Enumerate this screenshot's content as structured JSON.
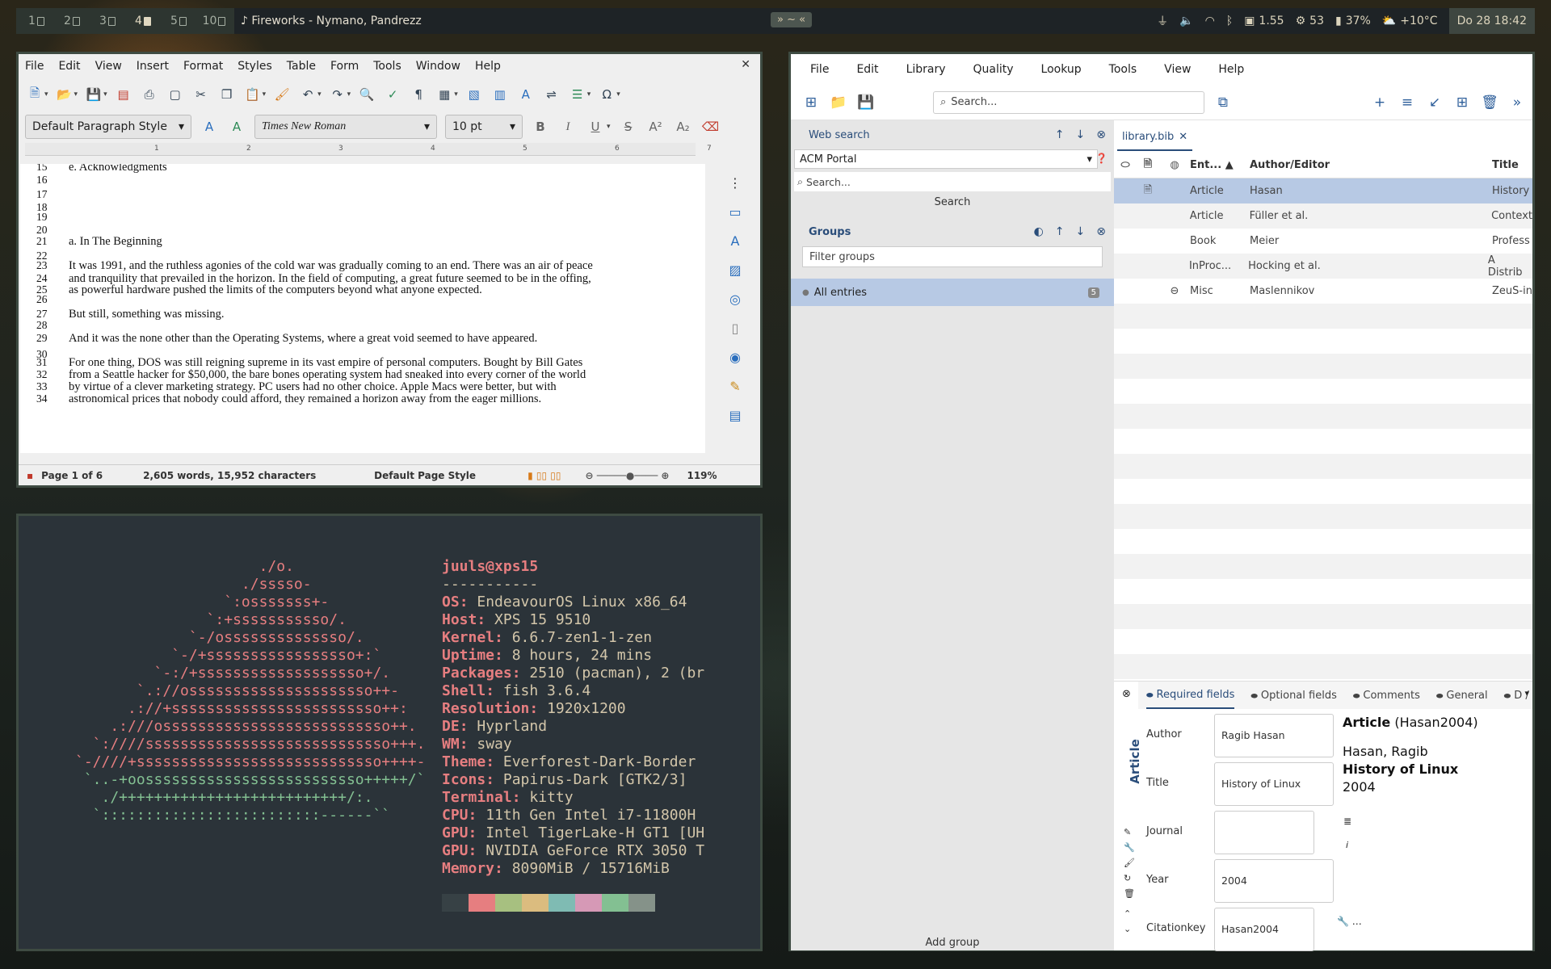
{
  "topbar": {
    "workspaces": [
      {
        "num": "1",
        "active": false
      },
      {
        "num": "2",
        "active": false
      },
      {
        "num": "3",
        "active": false
      },
      {
        "num": "4",
        "active": true
      },
      {
        "num": "5",
        "active": false
      },
      {
        "num": "10",
        "active": false
      }
    ],
    "now_playing": "♪ Fireworks - Nymano, Pandrezz",
    "center_tag": "» ~ «",
    "cpu_load": "1.55",
    "mem": "53",
    "battery": "37%",
    "weather": "+10°C",
    "clock": "Do 28 18:42"
  },
  "writer": {
    "menu": [
      "File",
      "Edit",
      "View",
      "Insert",
      "Format",
      "Styles",
      "Table",
      "Form",
      "Tools",
      "Window",
      "Help"
    ],
    "paragraph_style": "Default Paragraph Style",
    "font_name": "Times New Roman",
    "font_size": "10 pt",
    "ruler_marks": [
      "1",
      "2",
      "3",
      "4",
      "5",
      "6",
      "7"
    ],
    "doc_lines": [
      {
        "n": "15",
        "t": "   e. Acknowledgments"
      },
      {
        "n": "16",
        "t": ""
      },
      {
        "n": "17",
        "t": ""
      },
      {
        "n": "18",
        "t": ""
      },
      {
        "n": "19",
        "t": ""
      },
      {
        "n": "20",
        "t": ""
      },
      {
        "n": "21",
        "t": "a. In The Beginning"
      },
      {
        "n": "22",
        "t": ""
      },
      {
        "n": "23",
        "t": "It was 1991, and the ruthless agonies of the cold war was gradually coming to an end. There was an air of peace"
      },
      {
        "n": "24",
        "t": "and tranquility that prevailed in the horizon. In the field of computing, a great future seemed to be in the offing,"
      },
      {
        "n": "25",
        "t": "as powerful hardware pushed the limits of the computers beyond what anyone expected."
      },
      {
        "n": "26",
        "t": ""
      },
      {
        "n": "27",
        "t": "But still, something was missing."
      },
      {
        "n": "28",
        "t": ""
      },
      {
        "n": "29",
        "t": "And it was the none other than the Operating Systems, where a great void seemed to have appeared."
      },
      {
        "n": "30",
        "t": ""
      },
      {
        "n": "31",
        "t": "For one thing, DOS was still reigning supreme in its vast empire of personal computers. Bought by Bill Gates"
      },
      {
        "n": "32",
        "t": "from a Seattle hacker for $50,000, the bare bones operating system had sneaked into every corner of the world"
      },
      {
        "n": "33",
        "t": "by virtue of a clever marketing strategy. PC users had no other choice. Apple Macs were better, but with"
      },
      {
        "n": "34",
        "t": "astronomical prices that nobody could afford, they remained a horizon away from the eager millions."
      }
    ],
    "status": {
      "page": "Page 1 of 6",
      "words": "2,605 words, 15,952 characters",
      "page_style": "Default Page Style",
      "zoom": "119%"
    }
  },
  "terminal": {
    "ascii_lines": [
      {
        "t": "                     ./o.",
        "c": "#e67e80"
      },
      {
        "t": "                   ./sssso-",
        "c": "#e67e80"
      },
      {
        "t": "                 `:osssssss+-",
        "c": "#e67e80"
      },
      {
        "t": "               `:+sssssssssso/.",
        "c": "#e67e80"
      },
      {
        "t": "             `-/ossssssssssssso/.",
        "c": "#e67e80"
      },
      {
        "t": "           `-/+sssssssssssssssso+:`",
        "c": "#e67e80"
      },
      {
        "t": "         `-:/+sssssssssssssssssso+/.",
        "c": "#e67e80"
      },
      {
        "t": "       `.://osssssssssssssssssssso++-",
        "c": "#e67e80"
      },
      {
        "t": "      .://+ssssssssssssssssssssssso++:",
        "c": "#e67e80"
      },
      {
        "t": "    .:///ossssssssssssssssssssssssso++.",
        "c": "#e67e80"
      },
      {
        "t": "  `:////ssssssssssssssssssssssssssso+++.",
        "c": "#e67e80"
      },
      {
        "t": "`-////+ssssssssssssssssssssssssssso++++-",
        "c": "#e67e80"
      },
      {
        "t": " `..-+oosssssssssssssssssssssssso+++++/`",
        "c": "#83c092"
      },
      {
        "t": "   ./++++++++++++++++++++++++++/:.",
        "c": "#83c092"
      },
      {
        "t": "  `:::::::::::::::::::::::::------``",
        "c": "#83c092"
      }
    ],
    "user": "juuls@xps15",
    "separator": "-----------",
    "info": [
      {
        "k": "OS",
        "v": "EndeavourOS Linux x86_64"
      },
      {
        "k": "Host",
        "v": "XPS 15 9510"
      },
      {
        "k": "Kernel",
        "v": "6.6.7-zen1-1-zen"
      },
      {
        "k": "Uptime",
        "v": "8 hours, 24 mins"
      },
      {
        "k": "Packages",
        "v": "2510 (pacman), 2 (br"
      },
      {
        "k": "Shell",
        "v": "fish 3.6.4"
      },
      {
        "k": "Resolution",
        "v": "1920x1200"
      },
      {
        "k": "DE",
        "v": "Hyprland"
      },
      {
        "k": "WM",
        "v": "sway"
      },
      {
        "k": "Theme",
        "v": "Everforest-Dark-Border"
      },
      {
        "k": "Icons",
        "v": "Papirus-Dark [GTK2/3]"
      },
      {
        "k": "Terminal",
        "v": "kitty"
      },
      {
        "k": "CPU",
        "v": "11th Gen Intel i7-11800H"
      },
      {
        "k": "GPU",
        "v": "Intel TigerLake-H GT1 [UH"
      },
      {
        "k": "GPU",
        "v": "NVIDIA GeForce RTX 3050 T"
      },
      {
        "k": "Memory",
        "v": "8090MiB / 15716MiB"
      }
    ],
    "palette": [
      "#374145",
      "#e67e80",
      "#a7c080",
      "#dbbc7f",
      "#7fbbb3",
      "#d699b6",
      "#83c092",
      "#859289"
    ]
  },
  "jabref": {
    "menu": [
      "File",
      "Edit",
      "Library",
      "Quality",
      "Lookup",
      "Tools",
      "View",
      "Help"
    ],
    "search_placeholder": "Search...",
    "web_search": {
      "title": "Web search",
      "engine": "ACM Portal",
      "search_placeholder": "Search...",
      "search_button": "Search"
    },
    "groups": {
      "title": "Groups",
      "filter_placeholder": "Filter groups",
      "all_entries": "All entries",
      "count": "5",
      "add_group": "Add group"
    },
    "tab": "library.bib",
    "columns": {
      "entry": "Ent...",
      "author": "Author/Editor",
      "title": "Title"
    },
    "entries": [
      {
        "type": "Article",
        "author": "Hasan",
        "title": "History",
        "icon": "file",
        "selected": true
      },
      {
        "type": "Article",
        "author": "Füller et al.",
        "title": "Context",
        "icon": "",
        "selected": false
      },
      {
        "type": "Book",
        "author": "Meier",
        "title": "Profess",
        "icon": "",
        "selected": false
      },
      {
        "type": "InProc...",
        "author": "Hocking et al.",
        "title": "A Distrib",
        "icon": "",
        "selected": false
      },
      {
        "type": "Misc",
        "author": "Maslennikov",
        "title": "ZeuS-in",
        "icon": "link",
        "selected": false
      }
    ],
    "editor": {
      "tabs": [
        "Required fields",
        "Optional fields",
        "Comments",
        "General",
        "D /"
      ],
      "entry_type": "Article",
      "fields": [
        {
          "label": "Author",
          "value": "Ragib Hasan"
        },
        {
          "label": "Title",
          "value": "History of Linux"
        },
        {
          "label": "Journal",
          "value": ""
        },
        {
          "label": "Year",
          "value": "2004"
        },
        {
          "label": "Citationkey",
          "value": "Hasan2004"
        }
      ],
      "preview": {
        "type": "Article",
        "key": "(Hasan2004)",
        "author": "Hasan, Ragib",
        "title": "History of Linux",
        "year": "2004"
      }
    }
  }
}
